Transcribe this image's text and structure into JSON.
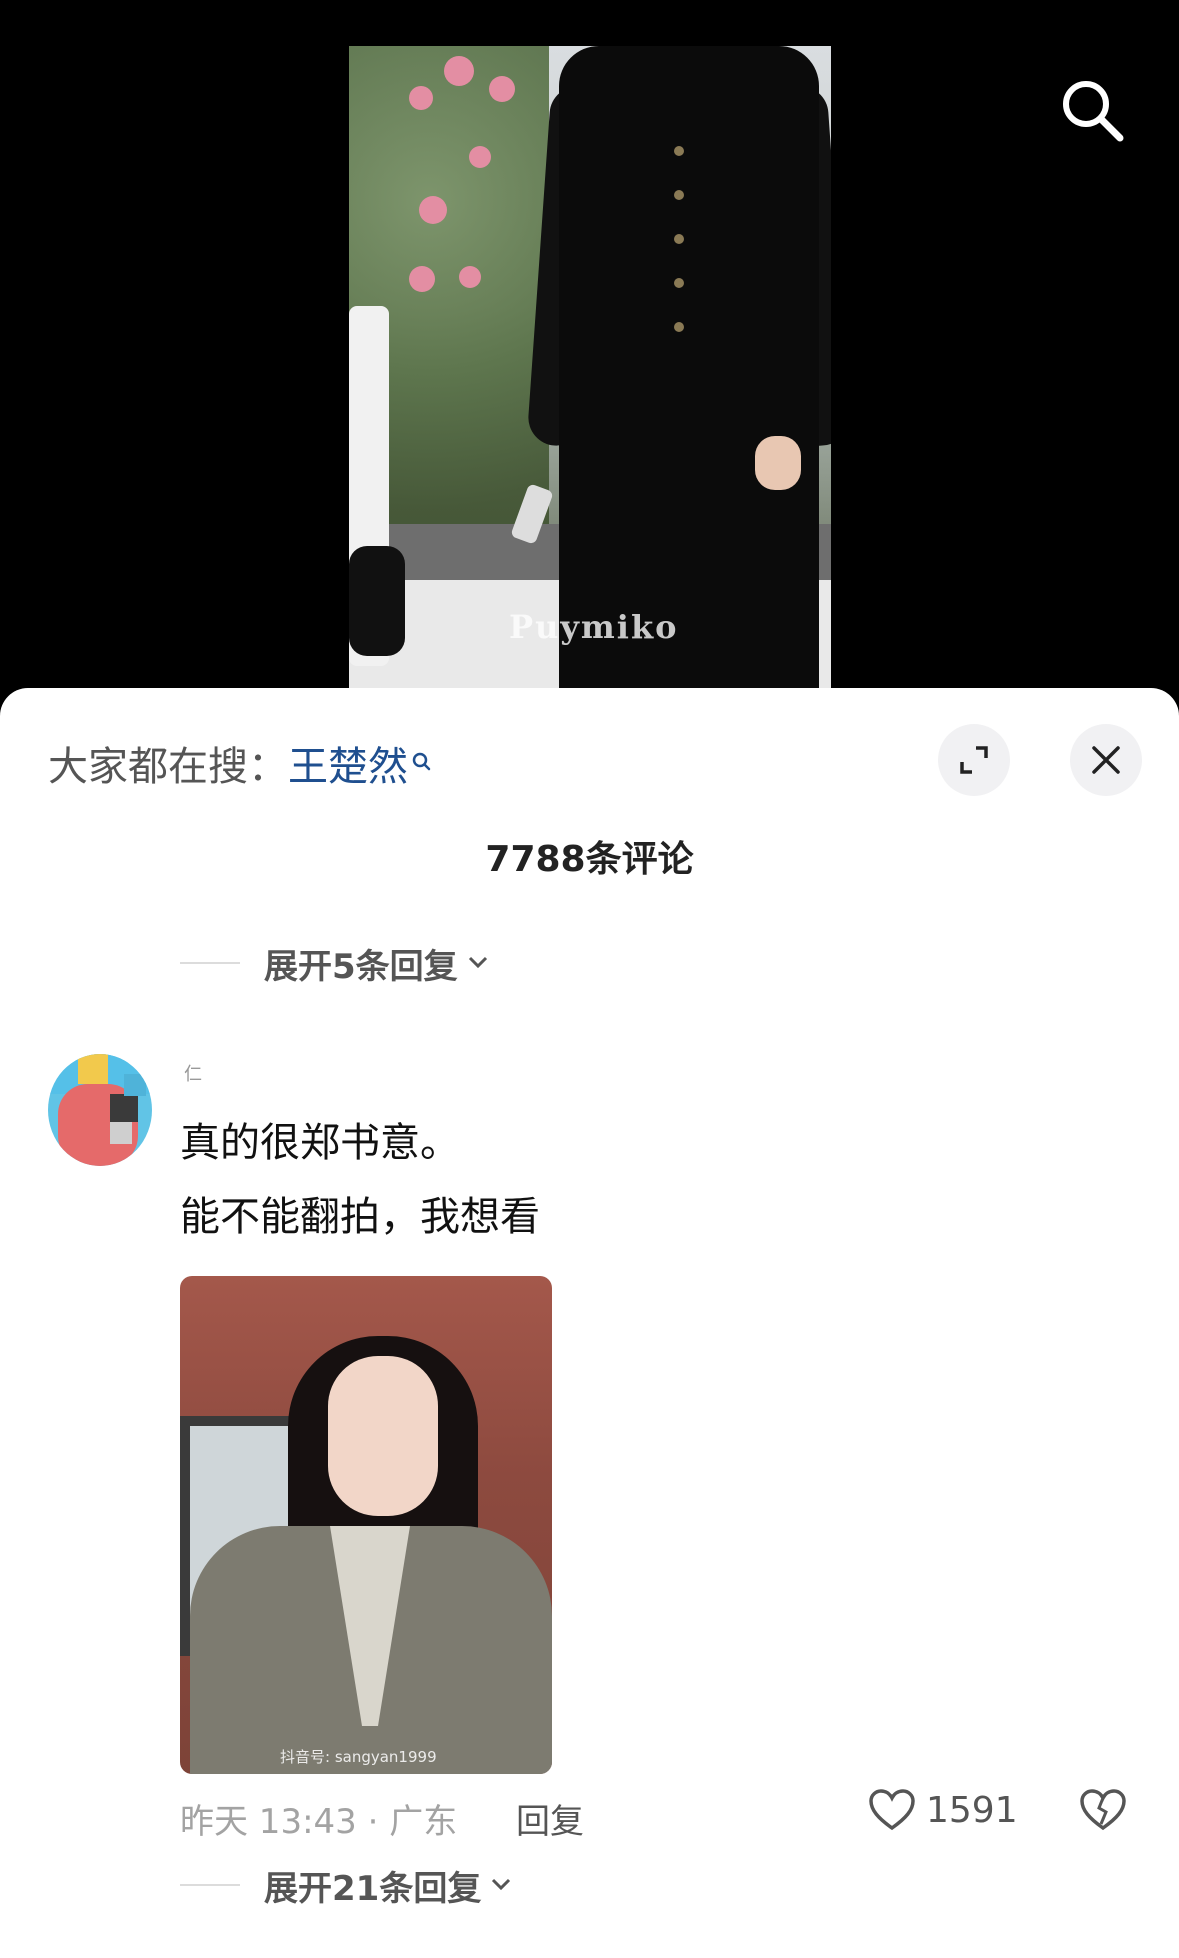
{
  "video": {
    "watermark": "Puymiko"
  },
  "top_bar": {
    "search_icon": "search-icon"
  },
  "comments_panel": {
    "hot_search_prefix": "大家都在搜：",
    "hot_search_keyword": "王楚然",
    "expand_icon": "expand-icon",
    "close_icon": "close-icon",
    "title": "7788条评论",
    "prev_expand_replies": "展开5条回复"
  },
  "comment": {
    "username": "仁",
    "text_line1": "真的很郑书意。",
    "text_line2": "能不能翻拍，我想看",
    "image_watermark": "抖音号: sangyan1999",
    "time_location": "昨天 13:43 · 广东",
    "reply_label": "回复",
    "like_count": "1591",
    "expand_replies": "展开21条回复"
  }
}
